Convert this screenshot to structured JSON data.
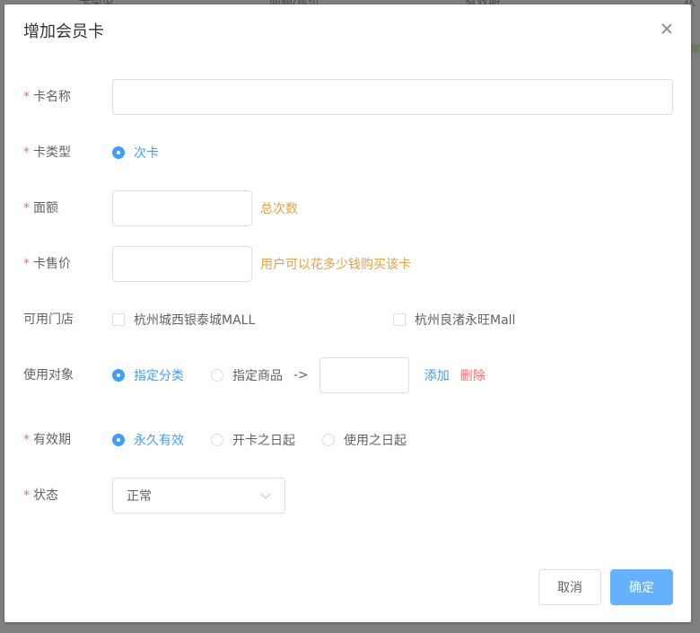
{
  "background": {
    "columns": [
      "卡类型",
      "面额/售价",
      "有效期",
      "状"
    ],
    "edge_text": "正常"
  },
  "dialog": {
    "title": "增加会员卡",
    "close_icon": "close-icon"
  },
  "form": {
    "required_mark": "*",
    "card_name": {
      "label": "卡名称",
      "value": "",
      "placeholder": ""
    },
    "card_type": {
      "label": "卡类型",
      "options": [
        "次卡"
      ],
      "selected": "次卡"
    },
    "face_value": {
      "label": "面额",
      "value": "",
      "hint": "总次数"
    },
    "price": {
      "label": "卡售价",
      "value": "",
      "hint": "用户可以花多少钱购买该卡"
    },
    "stores": {
      "label": "可用门店",
      "options": [
        "杭州城西银泰城MALL",
        "杭州良渚永旺Mall"
      ]
    },
    "target": {
      "label": "使用对象",
      "options": [
        "指定分类",
        "指定商品"
      ],
      "selected": "指定分类",
      "arrow": "->",
      "value": "",
      "add_label": "添加",
      "delete_label": "删除"
    },
    "validity": {
      "label": "有效期",
      "options": [
        "永久有效",
        "开卡之日起",
        "使用之日起"
      ],
      "selected": "永久有效"
    },
    "status": {
      "label": "状态",
      "value": "正常"
    }
  },
  "footer": {
    "cancel_label": "取消",
    "ok_label": "确定"
  },
  "colors": {
    "primary": "#409eff",
    "primary_light": "#66b1ff",
    "danger": "#f56c6c",
    "warning": "#e6a23c"
  }
}
